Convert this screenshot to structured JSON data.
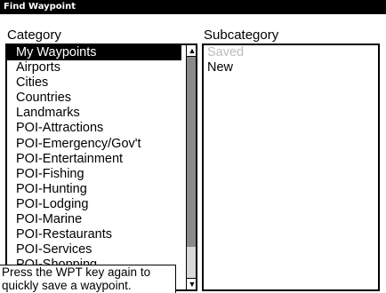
{
  "window": {
    "title": "Find Waypoint"
  },
  "category": {
    "heading": "Category",
    "items": [
      {
        "label": "My Waypoints",
        "selected": true
      },
      {
        "label": "Airports"
      },
      {
        "label": "Cities"
      },
      {
        "label": "Countries"
      },
      {
        "label": "Landmarks"
      },
      {
        "label": "POI-Attractions"
      },
      {
        "label": "POI-Emergency/Gov't"
      },
      {
        "label": "POI-Entertainment"
      },
      {
        "label": "POI-Fishing"
      },
      {
        "label": "POI-Hunting"
      },
      {
        "label": "POI-Lodging"
      },
      {
        "label": "POI-Marine"
      },
      {
        "label": "POI-Restaurants"
      },
      {
        "label": "POI-Services"
      },
      {
        "label": "POI-Shopping"
      }
    ]
  },
  "subcategory": {
    "heading": "Subcategory",
    "items": [
      {
        "label": "Saved",
        "disabled": true
      },
      {
        "label": "New"
      }
    ]
  },
  "tooltip": {
    "line1": "Press the WPT key again to",
    "line2": "quickly save a waypoint."
  },
  "icons": {
    "scroll_up": "arrow-up-icon",
    "scroll_down": "arrow-down-icon"
  }
}
